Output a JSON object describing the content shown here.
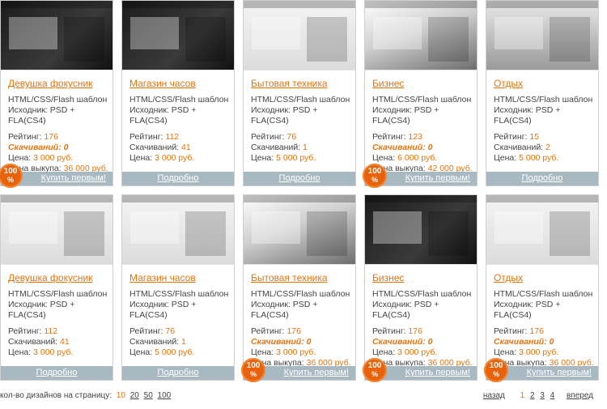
{
  "cards": [
    {
      "title": "Девушка фокусник",
      "format": "HTML/CSS/Flash шаблон",
      "source": "Исходник: PSD + FLA(CS4)",
      "rating_label": "Рейтинг:",
      "rating": "176",
      "downloads_label": "Скачиваний:",
      "downloads": "0",
      "price_label": "Цена:",
      "price": "3 000 руб.",
      "buyout_label": "Цена выкупа:",
      "buyout": "36 000 руб.",
      "footer": "Купить первым!",
      "badge": "100",
      "badge_pct": "%",
      "thumb": "dark"
    },
    {
      "title": "Магазин часов",
      "format": "HTML/CSS/Flash шаблон",
      "source": "Исходник: PSD + FLA(CS4)",
      "rating_label": "Рейтинг:",
      "rating": "112",
      "downloads_label": "Скачиваний:",
      "downloads": "41",
      "price_label": "Цена:",
      "price": "3 000 руб.",
      "footer": "Подробно",
      "thumb": "dark"
    },
    {
      "title": "Бытовая техника",
      "format": "HTML/CSS/Flash шаблон",
      "source": "Исходник: PSD + FLA(CS4)",
      "rating_label": "Рейтинг:",
      "rating": "76",
      "downloads_label": "Скачиваний:",
      "downloads": "1",
      "price_label": "Цена:",
      "price": "5 000 руб.",
      "footer": "Подробно",
      "thumb": "light"
    },
    {
      "title": "Бизнес",
      "format": "HTML/CSS/Flash шаблон",
      "source": "Исходник: PSD + FLA(CS4)",
      "rating_label": "Рейтинг:",
      "rating": "123",
      "downloads_label": "Скачиваний:",
      "downloads": "0",
      "price_label": "Цена:",
      "price": "6 000 руб.",
      "buyout_label": "Цена выкупа:",
      "buyout": "42 000 руб.",
      "footer": "Купить первым!",
      "badge": "100",
      "badge_pct": "%",
      "thumb": "photo"
    },
    {
      "title": "Отдых",
      "format": "HTML/CSS/Flash шаблон",
      "source": "Исходник: PSD + FLA(CS4)",
      "rating_label": "Рейтинг:",
      "rating": "15",
      "downloads_label": "Скачиваний:",
      "downloads": "2",
      "price_label": "Цена:",
      "price": "5 000 руб.",
      "footer": "Подробно",
      "thumb": "mid"
    },
    {
      "title": "Девушка фокусник",
      "format": "HTML/CSS/Flash шаблон",
      "source": "Исходник: PSD + FLA(CS4)",
      "rating_label": "Рейтинг:",
      "rating": "112",
      "downloads_label": "Скачиваний:",
      "downloads": "41",
      "price_label": "Цена:",
      "price": "3 000 руб.",
      "footer": "Подробно",
      "thumb": "light"
    },
    {
      "title": "Магазин часов",
      "format": "HTML/CSS/Flash шаблон",
      "source": "Исходник: PSD + FLA(CS4)",
      "rating_label": "Рейтинг:",
      "rating": "76",
      "downloads_label": "Скачиваний:",
      "downloads": "1",
      "price_label": "Цена:",
      "price": "5 000 руб.",
      "footer": "Подробно",
      "thumb": "light"
    },
    {
      "title": "Бытовая техника",
      "format": "HTML/CSS/Flash шаблон",
      "source": "Исходник: PSD + FLA(CS4)",
      "rating_label": "Рейтинг:",
      "rating": "176",
      "downloads_label": "Скачиваний:",
      "downloads": "0",
      "price_label": "Цена:",
      "price": "3 000 руб.",
      "buyout_label": "Цена выкупа:",
      "buyout": "36 000 руб.",
      "footer": "Купить первым!",
      "badge": "100",
      "badge_pct": "%",
      "thumb": "photo"
    },
    {
      "title": "Бизнес",
      "format": "HTML/CSS/Flash шаблон",
      "source": "Исходник: PSD + FLA(CS4)",
      "rating_label": "Рейтинг:",
      "rating": "176",
      "downloads_label": "Скачиваний:",
      "downloads": "0",
      "price_label": "Цена:",
      "price": "3 000 руб.",
      "buyout_label": "Цена выкупа:",
      "buyout": "36 000 руб.",
      "footer": "Купить первым!",
      "badge": "100",
      "badge_pct": "%",
      "thumb": "dark"
    },
    {
      "title": "Отдых",
      "format": "HTML/CSS/Flash шаблон",
      "source": "Исходник: PSD + FLA(CS4)",
      "rating_label": "Рейтинг:",
      "rating": "176",
      "downloads_label": "Скачиваний:",
      "downloads": "0",
      "price_label": "Цена:",
      "price": "3 000 руб.",
      "buyout_label": "Цена выкупа:",
      "buyout": "36 000 руб.",
      "footer": "Купить первым!",
      "badge": "100",
      "badge_pct": "%",
      "thumb": "light"
    }
  ],
  "per_page": {
    "label": "кол-во дизайнов на страницу:",
    "options": [
      "10",
      "20",
      "50",
      "100"
    ],
    "selected": "10"
  },
  "pagination": {
    "prev": "назад",
    "pages": [
      "1",
      "2",
      "3",
      "4"
    ],
    "current": "1",
    "next": "вперед"
  },
  "colors": {
    "accent": "#e8730c",
    "footer_bar": "#a9b9c2",
    "badge": "#e8620c"
  }
}
